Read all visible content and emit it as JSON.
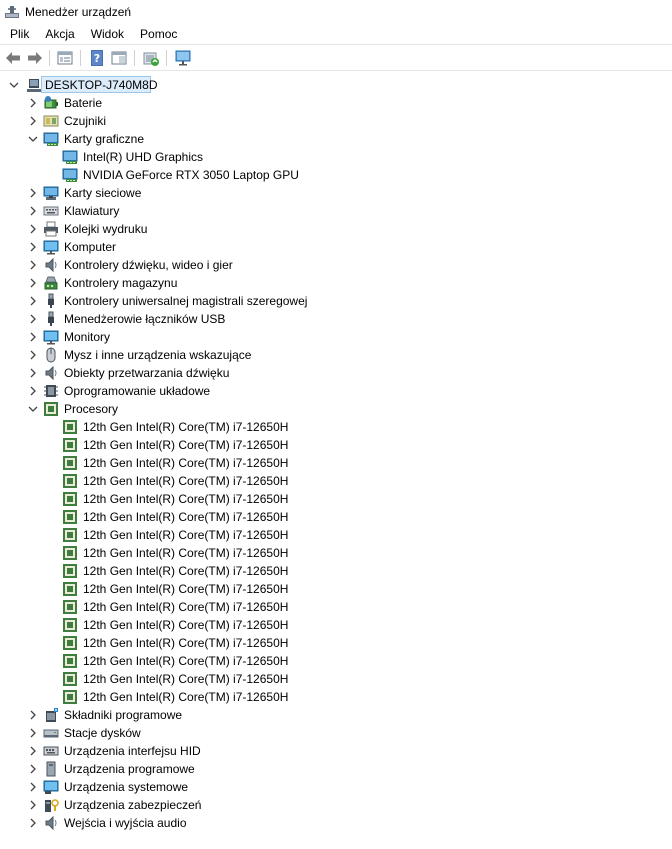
{
  "window": {
    "title": "Menedżer urządzeń"
  },
  "menu": [
    "Plik",
    "Akcja",
    "Widok",
    "Pomoc"
  ],
  "toolbar": [
    "back-icon",
    "forward-icon",
    "properties-view-icon",
    "help-icon",
    "show-hide-icon",
    "update-driver-icon",
    "monitor-scan-icon"
  ],
  "tree": {
    "root": "DESKTOP-J740M8D",
    "rows": [
      {
        "label": "Baterie",
        "level": 1,
        "expander": "collapsed",
        "icon": "battery-icon"
      },
      {
        "label": "Czujniki",
        "level": 1,
        "expander": "collapsed",
        "icon": "sensor-icon"
      },
      {
        "label": "Karty graficzne",
        "level": 1,
        "expander": "expanded",
        "icon": "display-adapter-icon"
      },
      {
        "label": "Intel(R) UHD Graphics",
        "level": 2,
        "expander": "none",
        "icon": "display-adapter-icon"
      },
      {
        "label": "NVIDIA GeForce RTX 3050 Laptop GPU",
        "level": 2,
        "expander": "none",
        "icon": "display-adapter-icon"
      },
      {
        "label": "Karty sieciowe",
        "level": 1,
        "expander": "collapsed",
        "icon": "network-adapter-icon"
      },
      {
        "label": "Klawiatury",
        "level": 1,
        "expander": "collapsed",
        "icon": "keyboard-icon"
      },
      {
        "label": "Kolejki wydruku",
        "level": 1,
        "expander": "collapsed",
        "icon": "printer-icon"
      },
      {
        "label": "Komputer",
        "level": 1,
        "expander": "collapsed",
        "icon": "computer-icon"
      },
      {
        "label": "Kontrolery dźwięku, wideo i gier",
        "level": 1,
        "expander": "collapsed",
        "icon": "speaker-icon"
      },
      {
        "label": "Kontrolery magazynu",
        "level": 1,
        "expander": "collapsed",
        "icon": "storage-controller-icon"
      },
      {
        "label": "Kontrolery uniwersalnej magistrali szeregowej",
        "level": 1,
        "expander": "collapsed",
        "icon": "usb-icon"
      },
      {
        "label": "Menedżerowie łączników USB",
        "level": 1,
        "expander": "collapsed",
        "icon": "usb-icon"
      },
      {
        "label": "Monitory",
        "level": 1,
        "expander": "collapsed",
        "icon": "monitor-icon"
      },
      {
        "label": "Mysz i inne urządzenia wskazujące",
        "level": 1,
        "expander": "collapsed",
        "icon": "mouse-icon"
      },
      {
        "label": "Obiekty przetwarzania dźwięku",
        "level": 1,
        "expander": "collapsed",
        "icon": "speaker-icon"
      },
      {
        "label": "Oprogramowanie układowe",
        "level": 1,
        "expander": "collapsed",
        "icon": "firmware-icon"
      },
      {
        "label": "Procesory",
        "level": 1,
        "expander": "expanded",
        "icon": "processor-icon"
      },
      {
        "label": "12th Gen Intel(R) Core(TM) i7-12650H",
        "level": 2,
        "expander": "none",
        "icon": "processor-icon"
      },
      {
        "label": "12th Gen Intel(R) Core(TM) i7-12650H",
        "level": 2,
        "expander": "none",
        "icon": "processor-icon"
      },
      {
        "label": "12th Gen Intel(R) Core(TM) i7-12650H",
        "level": 2,
        "expander": "none",
        "icon": "processor-icon"
      },
      {
        "label": "12th Gen Intel(R) Core(TM) i7-12650H",
        "level": 2,
        "expander": "none",
        "icon": "processor-icon"
      },
      {
        "label": "12th Gen Intel(R) Core(TM) i7-12650H",
        "level": 2,
        "expander": "none",
        "icon": "processor-icon"
      },
      {
        "label": "12th Gen Intel(R) Core(TM) i7-12650H",
        "level": 2,
        "expander": "none",
        "icon": "processor-icon"
      },
      {
        "label": "12th Gen Intel(R) Core(TM) i7-12650H",
        "level": 2,
        "expander": "none",
        "icon": "processor-icon"
      },
      {
        "label": "12th Gen Intel(R) Core(TM) i7-12650H",
        "level": 2,
        "expander": "none",
        "icon": "processor-icon"
      },
      {
        "label": "12th Gen Intel(R) Core(TM) i7-12650H",
        "level": 2,
        "expander": "none",
        "icon": "processor-icon"
      },
      {
        "label": "12th Gen Intel(R) Core(TM) i7-12650H",
        "level": 2,
        "expander": "none",
        "icon": "processor-icon"
      },
      {
        "label": "12th Gen Intel(R) Core(TM) i7-12650H",
        "level": 2,
        "expander": "none",
        "icon": "processor-icon"
      },
      {
        "label": "12th Gen Intel(R) Core(TM) i7-12650H",
        "level": 2,
        "expander": "none",
        "icon": "processor-icon"
      },
      {
        "label": "12th Gen Intel(R) Core(TM) i7-12650H",
        "level": 2,
        "expander": "none",
        "icon": "processor-icon"
      },
      {
        "label": "12th Gen Intel(R) Core(TM) i7-12650H",
        "level": 2,
        "expander": "none",
        "icon": "processor-icon"
      },
      {
        "label": "12th Gen Intel(R) Core(TM) i7-12650H",
        "level": 2,
        "expander": "none",
        "icon": "processor-icon"
      },
      {
        "label": "12th Gen Intel(R) Core(TM) i7-12650H",
        "level": 2,
        "expander": "none",
        "icon": "processor-icon"
      },
      {
        "label": "Składniki programowe",
        "level": 1,
        "expander": "collapsed",
        "icon": "software-component-icon"
      },
      {
        "label": "Stacje dysków",
        "level": 1,
        "expander": "collapsed",
        "icon": "disk-drive-icon"
      },
      {
        "label": "Urządzenia interfejsu HID",
        "level": 1,
        "expander": "collapsed",
        "icon": "hid-icon"
      },
      {
        "label": "Urządzenia programowe",
        "level": 1,
        "expander": "collapsed",
        "icon": "software-device-icon"
      },
      {
        "label": "Urządzenia systemowe",
        "level": 1,
        "expander": "collapsed",
        "icon": "system-device-icon"
      },
      {
        "label": "Urządzenia zabezpieczeń",
        "level": 1,
        "expander": "collapsed",
        "icon": "security-device-icon"
      },
      {
        "label": "Wejścia i wyjścia audio",
        "level": 1,
        "expander": "collapsed",
        "icon": "audio-io-icon"
      }
    ]
  }
}
